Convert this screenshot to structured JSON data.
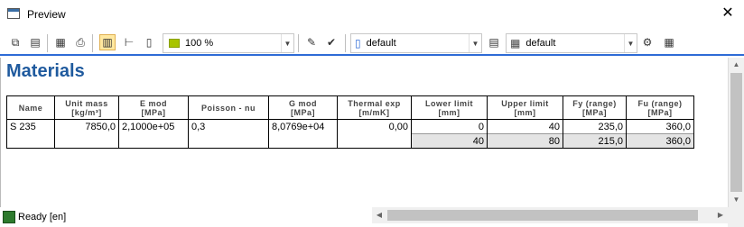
{
  "window": {
    "title": "Preview",
    "close_glyph": "✕"
  },
  "toolbar": {
    "zoom": "100 %",
    "style1": "default",
    "style2": "default",
    "icons": [
      "copy-icon",
      "export-icon",
      "print-preview-icon",
      "print-icon",
      "page-layout-icon",
      "page-width-icon",
      "page-icon",
      "image-export-icon",
      "image-export-green-icon",
      "page-style-icon",
      "book-icon",
      "table-icon",
      "settings-icon",
      "grid-icon"
    ]
  },
  "content": {
    "heading": "Materials",
    "columns": [
      {
        "name": "Name",
        "unit": ""
      },
      {
        "name": "Unit mass",
        "unit": "[kg/m³]"
      },
      {
        "name": "E mod",
        "unit": "[MPa]"
      },
      {
        "name": "Poisson - nu",
        "unit": ""
      },
      {
        "name": "G mod",
        "unit": "[MPa]"
      },
      {
        "name": "Thermal exp",
        "unit": "[m/mK]"
      },
      {
        "name": "Lower limit",
        "unit": "[mm]"
      },
      {
        "name": "Upper limit",
        "unit": "[mm]"
      },
      {
        "name": "Fy (range)",
        "unit": "[MPa]"
      },
      {
        "name": "Fu (range)",
        "unit": "[MPa]"
      }
    ],
    "row": {
      "name": "S 235",
      "unit_mass": "7850,0",
      "e_mod": "2,1000e+05",
      "poisson": "0,3",
      "g_mod": "8,0769e+04",
      "thermal": "0,00",
      "ranges": [
        {
          "lower": "0",
          "upper": "40",
          "fy": "235,0",
          "fu": "360,0"
        },
        {
          "lower": "40",
          "upper": "80",
          "fy": "215,0",
          "fu": "360,0"
        }
      ]
    }
  },
  "status": {
    "text": "Ready [en]"
  }
}
